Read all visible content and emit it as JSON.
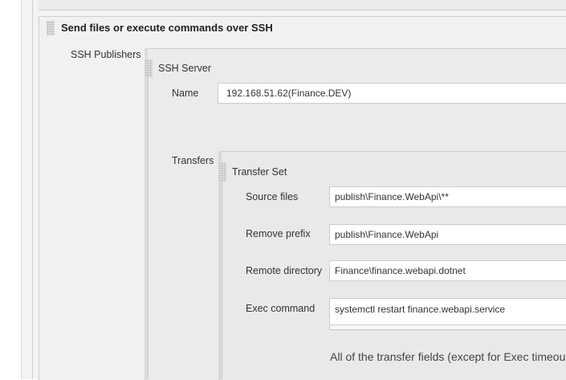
{
  "section": {
    "title": "Send files or execute commands over SSH"
  },
  "ssh_publishers": {
    "label": "SSH Publishers",
    "server_header": "SSH Server",
    "name_label": "Name",
    "name_value": "192.168.51.62(Finance.DEV)",
    "transfers_label": "Transfers",
    "transfer_set": {
      "header": "Transfer Set",
      "source_files_label": "Source files",
      "source_files_value": "publish\\Finance.WebApi\\**",
      "remove_prefix_label": "Remove prefix",
      "remove_prefix_value": "publish\\Finance.WebApi",
      "remote_directory_label": "Remote directory",
      "remote_directory_value": "Finance\\finance.webapi.dotnet",
      "exec_command_label": "Exec command",
      "exec_command_value": "systemctl restart finance.webapi.service",
      "help_text": "All of the transfer fields (except for Exec timeou"
    }
  }
}
